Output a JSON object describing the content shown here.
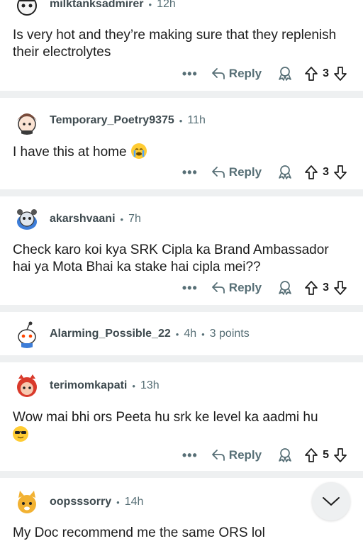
{
  "comments": [
    {
      "user": "milktanksadmirer",
      "age": "12h",
      "text": "Is very hot and they’re making sure that they replenish their electrolytes",
      "reply": "Reply",
      "votes": "3",
      "avatar_color": "#2b2b2b"
    },
    {
      "user": "Temporary_Poetry9375",
      "age": "11h",
      "text": "I have this at home",
      "emoji": "crying-emoji",
      "reply": "Reply",
      "votes": "3",
      "avatar_color": "#7a4b3a"
    },
    {
      "user": "akarshvaani",
      "age": "7h",
      "text": "Check karo koi kya SRK Cipla ka Brand Ambassador hai ya Mota Bhai ka stake hai cipla mei??",
      "reply": "Reply",
      "votes": "3",
      "avatar_color": "#3d7dd8"
    },
    {
      "user": "Alarming_Possible_22",
      "age": "4h",
      "points": "3 points",
      "avatar_color": "#ff4500"
    },
    {
      "user": "terimomkapati",
      "age": "13h",
      "text": "Wow mai bhi ors Peeta hu srk ke level ka aadmi hu",
      "emoji": "sunglasses-emoji",
      "reply": "Reply",
      "votes": "5",
      "avatar_color": "#d93a2b"
    },
    {
      "user": "oopsssorry",
      "age": "14h",
      "text": "My Doc recommend me the same ORS lol",
      "avatar_color": "#f2b233"
    }
  ],
  "colors": {
    "meta": "#576f76",
    "separator": "#eef0f1",
    "text": "#1c1c1c"
  },
  "icons": [
    "more-icon",
    "reply-icon",
    "award-icon",
    "upvote-icon",
    "downvote-icon",
    "chevron-down-icon"
  ]
}
